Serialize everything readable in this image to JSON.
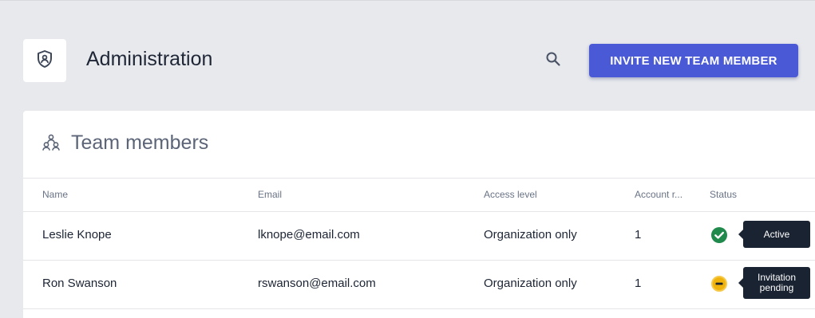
{
  "header": {
    "title": "Administration",
    "logo_icon": "shield-user-icon",
    "search_icon": "search-icon",
    "invite_label": "INVITE NEW TEAM MEMBER",
    "accent_color": "#4a5ad6"
  },
  "team": {
    "title": "Team members",
    "icon": "team-icon",
    "columns": [
      "Name",
      "Email",
      "Access level",
      "Account r...",
      "Status"
    ],
    "rows": [
      {
        "name": "Leslie Knope",
        "email": "lknope@email.com",
        "access": "Organization only",
        "account": "1",
        "status_icon": "check-circle-icon",
        "status_color": "#1f8a4c",
        "status_tooltip_lines": [
          "Active"
        ]
      },
      {
        "name": "Ron Swanson",
        "email": "rswanson@email.com",
        "access": "Organization only",
        "account": "1",
        "status_icon": "minus-circle-icon",
        "status_color": "#efb30c",
        "status_tooltip_lines": [
          "Invitation",
          "pending"
        ]
      }
    ]
  }
}
